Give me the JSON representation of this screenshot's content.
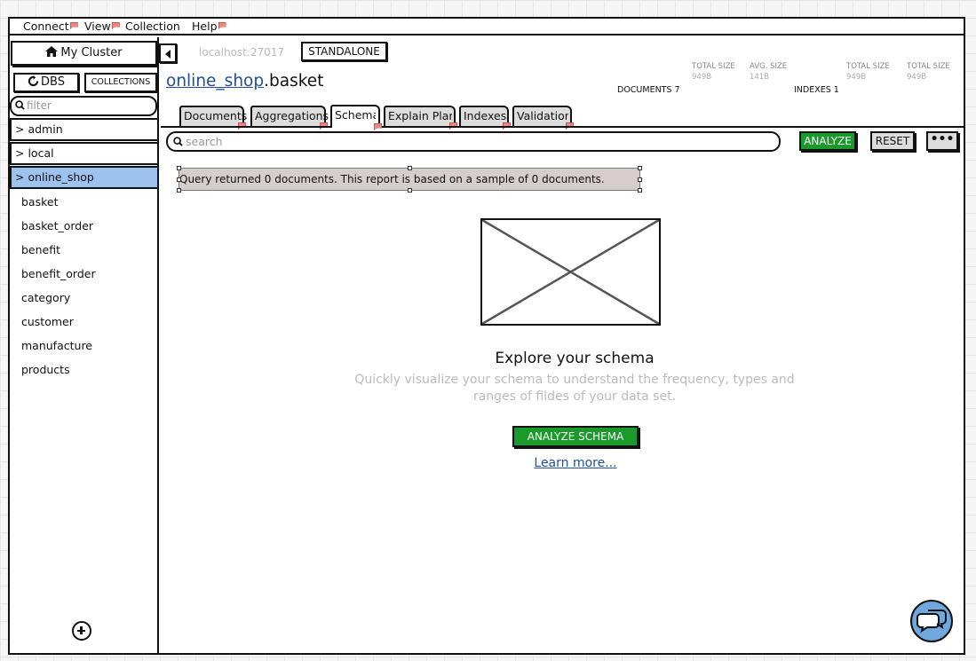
{
  "menu": {
    "items": [
      {
        "label": "Connect",
        "flag": true
      },
      {
        "label": "View",
        "flag": true
      },
      {
        "label": "Collection",
        "flag": false
      },
      {
        "label": "Help",
        "flag": true
      }
    ]
  },
  "sidebar": {
    "cluster_label": "My Cluster",
    "dbs_label": "DBS",
    "collections_label": "COLLECTIONS",
    "filter_placeholder": "filter",
    "databases": [
      {
        "label": "> admin",
        "selected": false
      },
      {
        "label": "> local",
        "selected": false
      },
      {
        "label": "> online_shop",
        "selected": true
      }
    ],
    "collections": [
      "basket",
      "basket_order",
      "benefit",
      "benefit_order",
      "category",
      "customer",
      "manufacture",
      "products"
    ]
  },
  "header": {
    "host": "localhost:27017",
    "topology": "STANDALONE",
    "namespace_db": "online_shop",
    "namespace_coll": ".basket",
    "stats": {
      "documents_label": "DOCUMENTS 7",
      "doc_total_size_label": "TOTAL SIZE",
      "doc_total_size_value": "949B",
      "doc_avg_size_label": "AVG. SIZE",
      "doc_avg_size_value": "141B",
      "indexes_label": "INDEXES 1",
      "idx_total_size_label": "TOTAL SIZE",
      "idx_total_size_value": "949B",
      "idx_avg_size_label": "TOTAL SIZE",
      "idx_avg_size_value": "949B"
    }
  },
  "tabs": [
    {
      "label": "Documents",
      "active": false
    },
    {
      "label": "Aggregations",
      "active": false
    },
    {
      "label": "Schema",
      "active": true
    },
    {
      "label": "Explain Plan",
      "active": false
    },
    {
      "label": "Indexes",
      "active": false
    },
    {
      "label": "Validation",
      "active": false
    }
  ],
  "toolbar": {
    "search_placeholder": "search",
    "analyze_label": "ANALYZE",
    "reset_label": "RESET",
    "more_label": "•••"
  },
  "notice": "Query returned 0 documents. This report is based on a sample of 0 documents.",
  "empty_state": {
    "title": "Explore your schema",
    "description_line1": "Quickly visualize your schema to understand the frequency, types and",
    "description_line2": "ranges of fildes of your data set.",
    "button_label": "ANALYZE SCHEMA",
    "link_label": "Learn more..."
  },
  "colors": {
    "primary_green": "#1a9a2a",
    "link_blue": "#1f4e9a",
    "selected_db": "#9ec2f0"
  }
}
